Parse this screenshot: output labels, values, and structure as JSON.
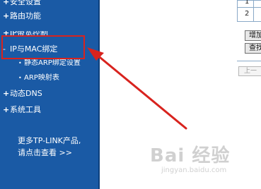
{
  "sidebar": {
    "items": [
      {
        "label": "安全设置",
        "marker": "+"
      },
      {
        "label": "路由功能",
        "marker": "+"
      },
      {
        "label": "IP带宽控制",
        "marker": "+"
      },
      {
        "label": "IP与MAC绑定",
        "marker": "-"
      },
      {
        "label": "动态DNS",
        "marker": "+"
      },
      {
        "label": "系统工具",
        "marker": "+"
      }
    ],
    "sub_items": [
      {
        "label": "静态ARP绑定设置",
        "marker": "•"
      },
      {
        "label": "ARP映射表",
        "marker": "•"
      }
    ],
    "promo": {
      "line1": "更多TP-LINK产品,",
      "line2": "请点击查看 >>"
    }
  },
  "content": {
    "row_numbers": [
      "1",
      "2"
    ],
    "buttons": [
      "增加",
      "查找"
    ],
    "page_button": "上一"
  },
  "watermark": {
    "main": "Bai 经验",
    "sub": "jingyan.baidu.com"
  },
  "colors": {
    "sidebar_bg": "#1a5aa5",
    "highlight": "#d8231e",
    "arrow": "#d8231e"
  }
}
